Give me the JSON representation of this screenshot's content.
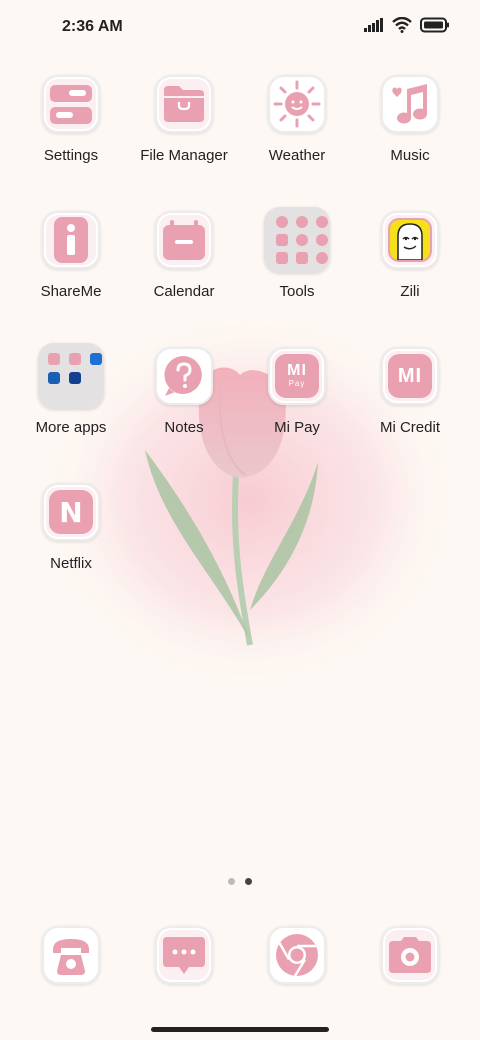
{
  "status": {
    "time": "2:36 AM",
    "signal_icon": "signal-icon",
    "wifi_icon": "wifi-icon",
    "battery_icon": "battery-icon"
  },
  "apps": [
    {
      "label": "Settings",
      "icon": "settings-icon"
    },
    {
      "label": "File Manager",
      "icon": "folder-icon"
    },
    {
      "label": "Weather",
      "icon": "sun-icon"
    },
    {
      "label": "Music",
      "icon": "music-note-icon"
    },
    {
      "label": "ShareMe",
      "icon": "info-icon"
    },
    {
      "label": "Calendar",
      "icon": "calendar-icon"
    },
    {
      "label": "Tools",
      "icon": "tools-folder-icon"
    },
    {
      "label": "Zili",
      "icon": "zili-icon"
    },
    {
      "label": "More apps",
      "icon": "folder-icon"
    },
    {
      "label": "Notes",
      "icon": "question-icon"
    },
    {
      "label": "Mi Pay",
      "icon": "mi-pay-icon",
      "icon_text": "MI",
      "icon_subtext": "Pay"
    },
    {
      "label": "Mi Credit",
      "icon": "mi-credit-icon",
      "icon_text": "MI"
    },
    {
      "label": "Netflix",
      "icon": "netflix-icon",
      "icon_text": "N"
    }
  ],
  "dock": [
    {
      "name": "phone",
      "icon": "phone-icon"
    },
    {
      "name": "messages",
      "icon": "chat-icon"
    },
    {
      "name": "browser",
      "icon": "browser-icon"
    },
    {
      "name": "camera",
      "icon": "camera-icon"
    }
  ],
  "pages": {
    "count": 2,
    "current": 2
  },
  "colors": {
    "accent": "#e9a1b2",
    "background": "#fdf8f3"
  }
}
